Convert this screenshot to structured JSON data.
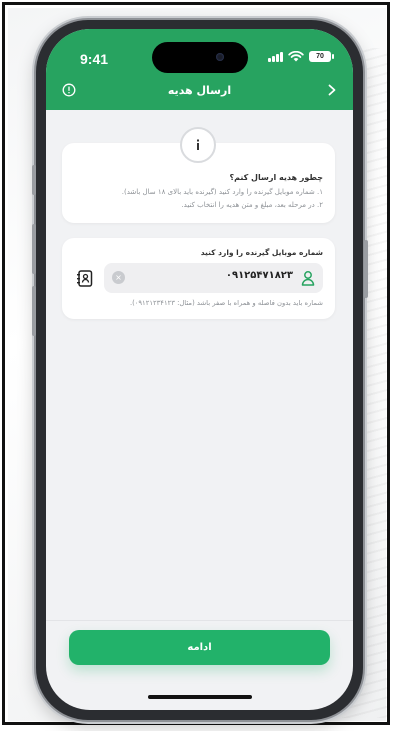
{
  "status_bar": {
    "time": "9:41",
    "battery": "70"
  },
  "header": {
    "title": "ارسال هدیه"
  },
  "info_card": {
    "title": "چطور هدیه ارسال کنم؟",
    "steps": [
      "۱. شماره موبایل گیرنده را وارد کنید (گیرنده باید بالای ۱۸ سال باشد).",
      "۲. در مرحله بعد، مبلغ و متن هدیه را انتخاب کنید."
    ]
  },
  "phone_card": {
    "label": "شماره موبایل گیرنده را وارد کنید",
    "value": "۰۹۱۲۵۴۷۱۸۲۳",
    "hint": "شماره باید بدون فاصله و همراه با صفر باشد (مثال: ۰۹۱۲۱۲۳۴۱۲۳)."
  },
  "footer": {
    "continue_label": "ادامه"
  },
  "colors": {
    "header_green": "#27a360",
    "button_green": "#22b26a"
  }
}
